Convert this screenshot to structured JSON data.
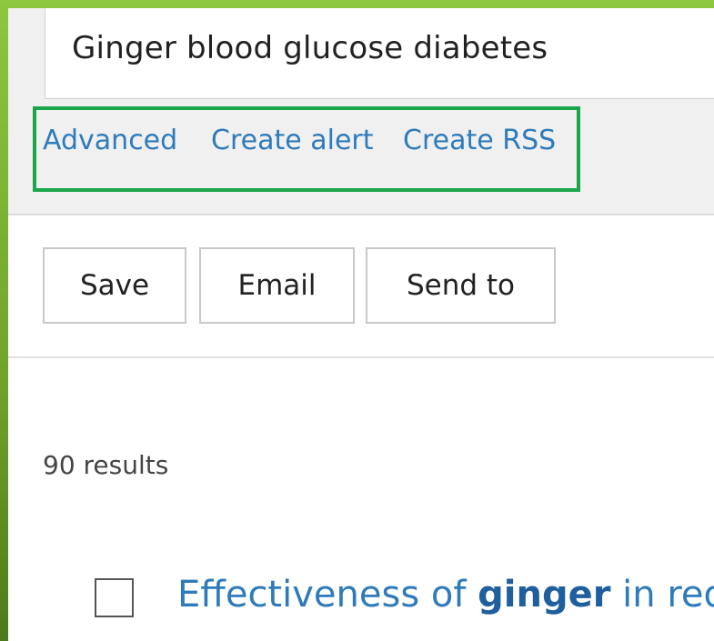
{
  "search": {
    "query": "Ginger blood glucose diabetes"
  },
  "links": {
    "advanced": "Advanced",
    "create_alert": "Create alert",
    "create_rss": "Create RSS"
  },
  "actions": {
    "save": "Save",
    "email": "Email",
    "send_to": "Send to"
  },
  "results": {
    "count": "90 results",
    "items": [
      {
        "title_prefix": "Effectiveness of ",
        "title_highlight": "ginger",
        "title_suffix": " in redu"
      }
    ]
  },
  "colors": {
    "link": "#2e7bbb",
    "highlight_border": "#1ba64a",
    "background_frame": "#8dc63f"
  }
}
